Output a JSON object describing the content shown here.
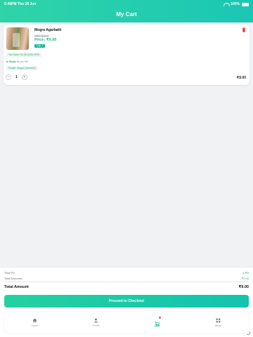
{
  "status_bar": {
    "time_date": "5:46PM   Thu 29 Jun",
    "battery": "100%"
  },
  "header": {
    "title": "My Cart"
  },
  "cart_item": {
    "name": "Mogra Agarbatti",
    "mrp": "MRP: ₹10.00",
    "price": "Price: ₹9.00",
    "quantity_badge": "Qty: 1",
    "savings": "You Save: ₹1.00 (10% OFF)",
    "stock_label": "In Stock",
    "stock_count": "84 pcs left",
    "variant": "Flower: Mogra (Jasmine)",
    "minus": "−",
    "plus": "+",
    "quantity": "1",
    "line_total": "₹9.00"
  },
  "summary": {
    "total_pv_label": "Total PV",
    "total_pv_value": "1 PV",
    "total_discount_label": "Total Discount",
    "total_discount_value": "- ₹1.00",
    "total_amount_label": "Total Amount",
    "total_amount_value": "₹9.00",
    "checkout_label": "Proceed to Checkout"
  },
  "nav": [
    {
      "label": "Home",
      "icon": "home-icon"
    },
    {
      "label": "Profile",
      "icon": "profile-icon"
    },
    {
      "label": "Cart",
      "icon": "cart-icon"
    },
    {
      "label": "Menu",
      "icon": "menu-icon"
    }
  ],
  "colors": {
    "accent": "#1bc7b4",
    "price": "#1fb58f",
    "danger": "#ff4d4f"
  }
}
